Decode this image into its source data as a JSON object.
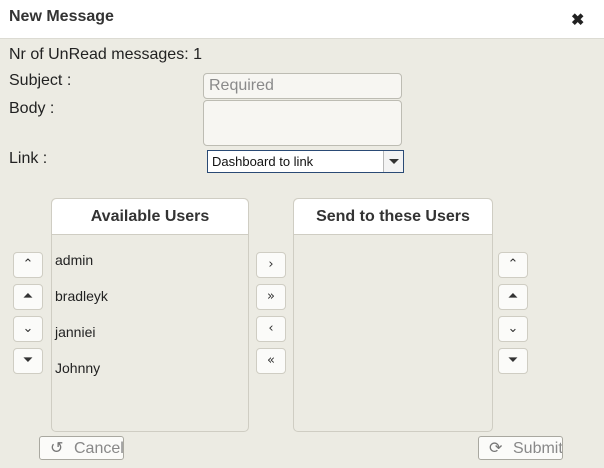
{
  "dialog": {
    "title": "New Message"
  },
  "form": {
    "unread_text": "Nr of UnRead messages: 1",
    "subject_label": "Subject :",
    "subject_placeholder": "Required",
    "body_label": "Body :",
    "link_label": "Link :",
    "link_selected": "Dashboard to link"
  },
  "available": {
    "header": "Available Users",
    "users": [
      "admin",
      "bradleyk",
      "janniei",
      "Johnny"
    ]
  },
  "selected": {
    "header": "Send to these Users",
    "users": []
  },
  "icons": {
    "close": "close-icon",
    "up": "chevron-up-icon",
    "top": "double-chevron-up-icon",
    "down": "chevron-down-icon",
    "bottom": "double-chevron-down-icon",
    "move_right": "chevron-right-icon",
    "move_all_right": "double-chevron-right-icon",
    "move_left": "chevron-left-icon",
    "move_all_left": "double-chevron-left-icon",
    "undo": "undo-icon",
    "refresh": "refresh-icon"
  },
  "footer": {
    "cancel_label": "Cancel",
    "submit_label": "Submit"
  }
}
